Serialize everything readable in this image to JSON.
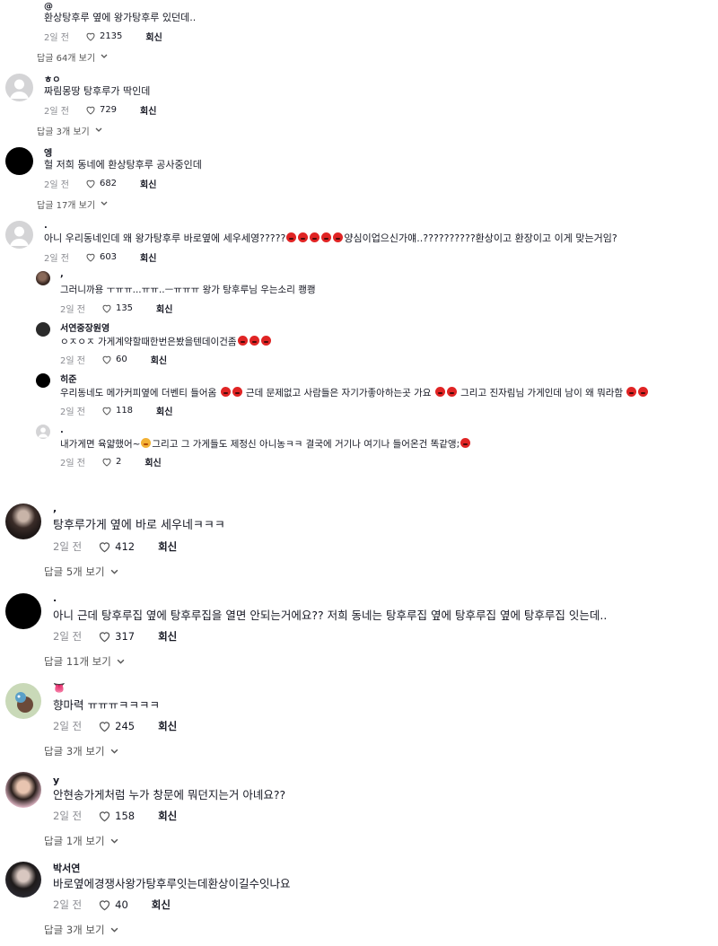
{
  "common": {
    "date": "2일 전",
    "reply": "회신"
  },
  "comments": [
    {
      "user": "@",
      "text": "환상탕후루 옆에 왕가탕후루 있던데..",
      "likes": "2135",
      "replies": "답글 64개 보기"
    },
    {
      "user": "ㅎㅇ",
      "text": "짜림몽땅 탕후루가 딱인데",
      "likes": "729",
      "replies": "답글 3개 보기"
    },
    {
      "user": "엥",
      "text": "헐 저희 동네에 환상탕후루 공사중인데",
      "likes": "682",
      "replies": "답글 17개 보기"
    },
    {
      "user": ".",
      "text_a": "아니 우리동네인데 왜 왕가탕후루 바로옆에 세우세영?????",
      "text_b": "양심이업으신가얘..??????????환상이고 환장이고 이게 맞는거임?",
      "likes": "603"
    },
    {
      "user": ",",
      "text": "그러니까용 ㅜㅠㅠ...ㅠㅠ..ㅡㅠㅠㅠ 왕가 탕후루님 우는소리 쾡쾡",
      "likes": "135"
    },
    {
      "user": "서연중장원영",
      "text_a": "ㅇㅈㅇㅈ 가게계약할때한번은봤을텐데이건좀",
      "likes": "60"
    },
    {
      "user": "히준",
      "text_a": "우리동네도 메가커피옆에 더벤티 들어옴 ",
      "text_b": " 근데 문제없고 사람들은 자기가좋아하는곳 가요 ",
      "text_c": " 그리고 진자림님 가게인데 남이 왜 뭐라함 ",
      "likes": "118"
    },
    {
      "user": ".",
      "text_a": "내가게면 육얇했어~",
      "text_b": "그리고 그 가게들도 제정신 아니농ㅋㅋ 결국에 거기나 여기나 들어온건 똑같앵;",
      "likes": "2"
    },
    {
      "user": ",",
      "text": "탕후루가게 옆에 바로 세우네ㅋㅋㅋ",
      "likes": "412",
      "replies": "답글 5개 보기"
    },
    {
      "user": ".",
      "text": "아니 근데 탕후루집 옆에 탕후루집을 열면 안되는거에요?? 저희 동네는 탕후루집 옆에 탕후루집 옆에 탕후루집 잇는데..",
      "likes": "317",
      "replies": "답글 11개 보기"
    },
    {
      "user": "👅",
      "text": "향마력 ㅠㅠㅠㅋㅋㅋㅋ",
      "likes": "245",
      "replies": "답글 3개 보기"
    },
    {
      "user": "y",
      "text": "안현송가게처럼 누가 창문에 뭐던지는거 아녜요??",
      "likes": "158",
      "replies": "답글 1개 보기"
    },
    {
      "user": "박서연",
      "text": "바로옆에경쟁사왕가탕후루잇는데환상이길수잇나요",
      "likes": "40",
      "replies": "답글 3개 보기"
    }
  ],
  "icons": {
    "heart": "heart-icon",
    "chevron": "chevron-down-icon"
  },
  "colors": {
    "meta": "#8a8b91",
    "reaction_emoji": "#e02424",
    "text": "#161823"
  }
}
